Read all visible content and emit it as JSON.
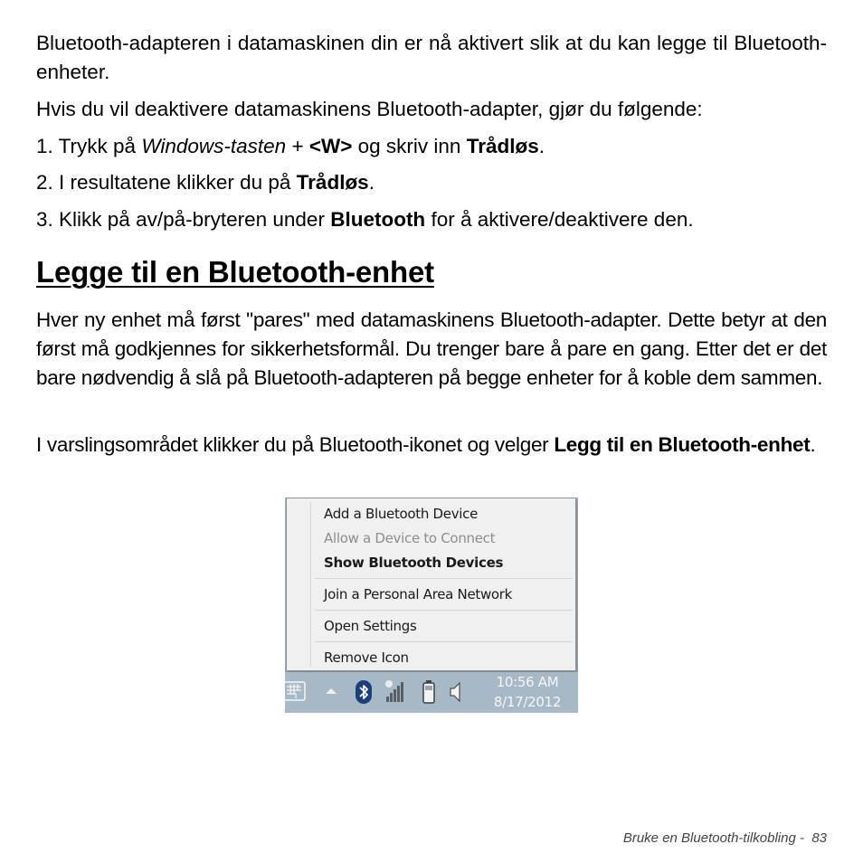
{
  "intro": {
    "p1": "Bluetooth-adapteren i datamaskinen din er nå aktivert slik at du kan legge til Bluetooth-enheter.",
    "p2": "Hvis du vil deaktivere datamaskinens Bluetooth-adapter, gjør du følgende:"
  },
  "steps": [
    {
      "num": "1.",
      "pre": "Trykk på ",
      "italic": "Windows-tasten",
      "mid": " + ",
      "bold1": "<W>",
      "mid2": " og skriv inn ",
      "bold2": "Trådløs",
      "post": "."
    },
    {
      "num": "2.",
      "pre": "I resultatene klikker du på ",
      "bold": "Trådløs",
      "post": "."
    },
    {
      "num": "3.",
      "pre": "Klikk på av/på-bryteren under ",
      "bold": "Bluetooth",
      "post": " for å aktivere/deaktivere den."
    }
  ],
  "section": {
    "heading": "Legge til en Bluetooth-enhet",
    "p1": "Hver ny enhet må først \"pares\" med datamaskinens Bluetooth-adapter. Dette betyr at den først må godkjennes for sikkerhetsformål. Du trenger bare å pare en gang. Etter det er det bare nødvendig å slå på Bluetooth-adapteren på begge enheter for å koble dem sammen.",
    "p2_pre": "I varslingsområdet klikker du på Bluetooth-ikonet og velger ",
    "p2_bold": "Legg til en Bluetooth-enhet",
    "p2_post": "."
  },
  "screenshot": {
    "menu_items": [
      {
        "label": "Add a Bluetooth Device",
        "state": "normal"
      },
      {
        "label": "Allow a Device to Connect",
        "state": "disabled"
      },
      {
        "label": "Show Bluetooth Devices",
        "state": "default-bold"
      },
      {
        "label": "Join a Personal Area Network",
        "state": "normal"
      },
      {
        "label": "Open Settings",
        "state": "normal"
      },
      {
        "label": "Remove Icon",
        "state": "normal"
      }
    ],
    "taskbar": {
      "icons": [
        "keyboard-icon",
        "show-hidden-icons-arrow",
        "bluetooth-icon",
        "wireless-signal-icon",
        "battery-icon",
        "volume-icon"
      ],
      "time": "10:56 AM",
      "date": "8/17/2012"
    },
    "colors": {
      "taskbar": "#a7b8c6",
      "menu_bg": "#f0f0f0",
      "bluetooth_badge": "#1b3f7a"
    }
  },
  "footer": {
    "chapter": "Bruke en Bluetooth-tilkobling -",
    "page": "83"
  }
}
